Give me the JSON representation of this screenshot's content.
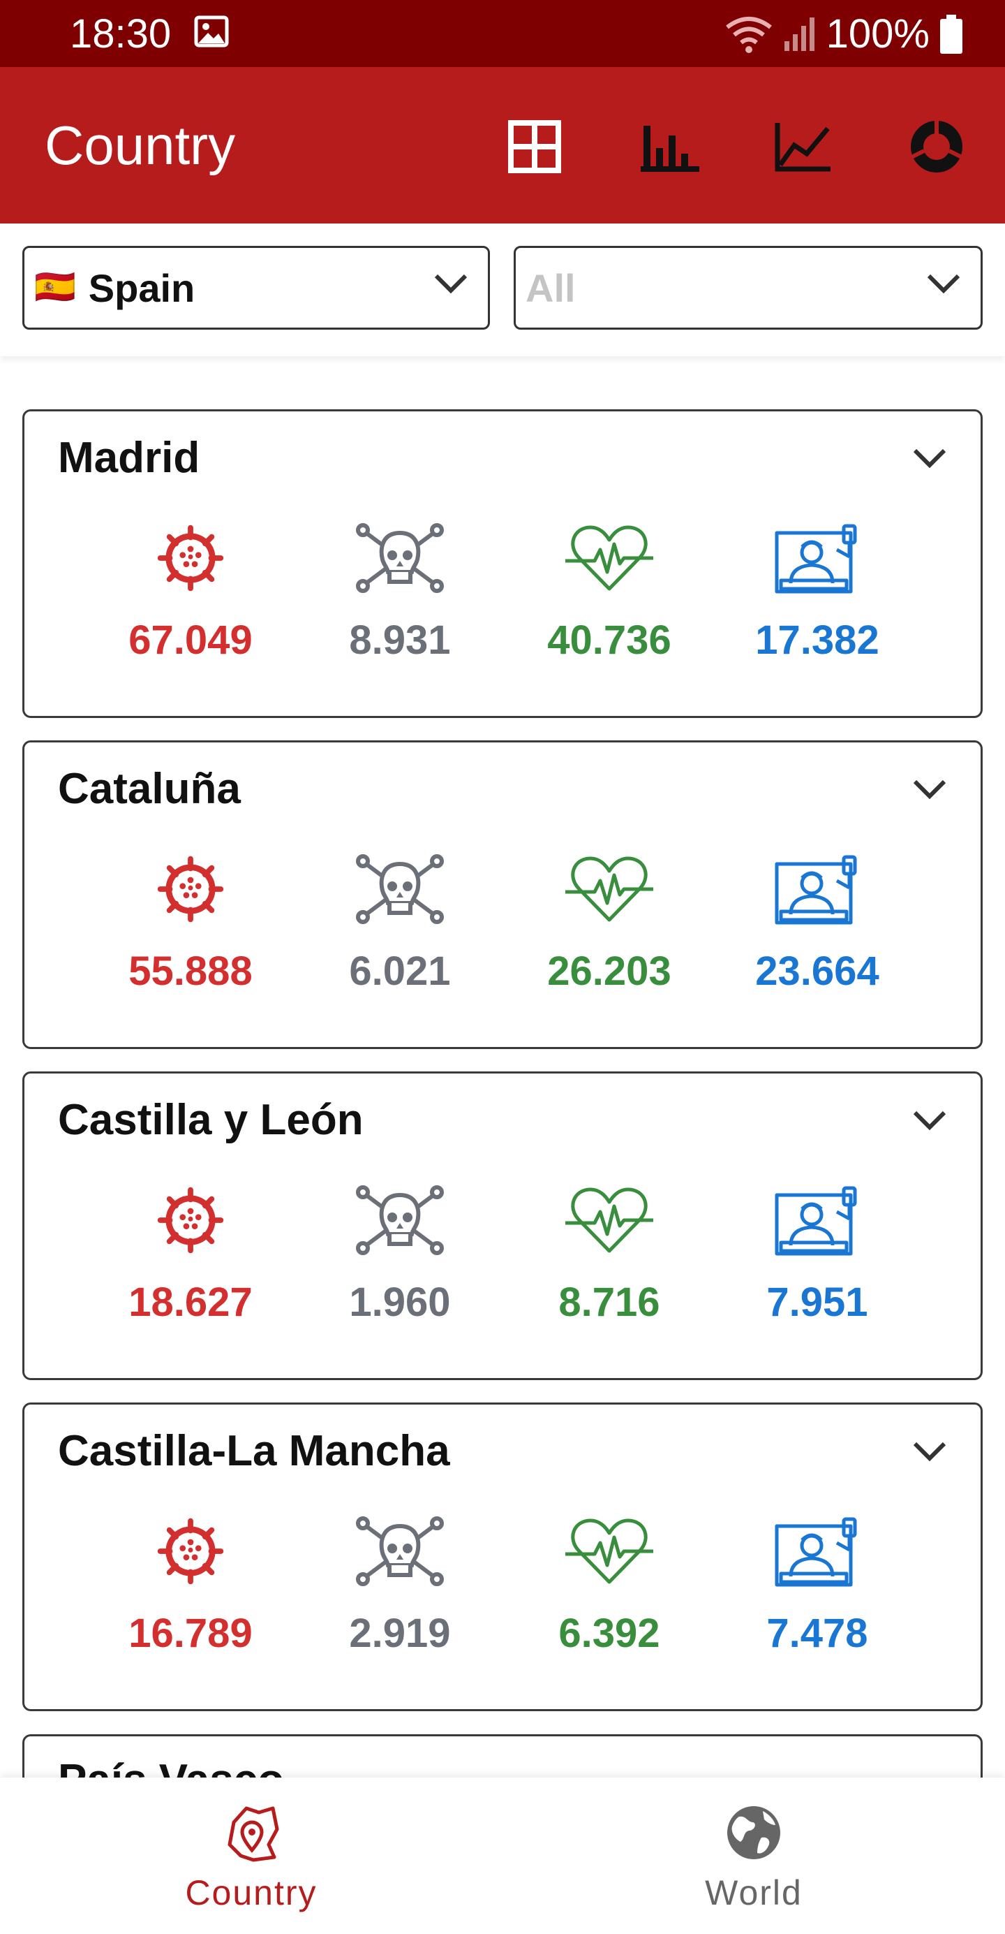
{
  "status": {
    "time": "18:30",
    "battery": "100%"
  },
  "app_bar": {
    "title": "Country"
  },
  "filters": {
    "country": {
      "flag": "🇪🇸",
      "value": "Spain"
    },
    "region": {
      "placeholder": "All"
    }
  },
  "regions": [
    {
      "name": "Madrid",
      "confirmed": "67.049",
      "deaths": "8.931",
      "recovered": "40.736",
      "hospitalized": "17.382"
    },
    {
      "name": "Cataluña",
      "confirmed": "55.888",
      "deaths": "6.021",
      "recovered": "26.203",
      "hospitalized": "23.664"
    },
    {
      "name": "Castilla y León",
      "confirmed": "18.627",
      "deaths": "1.960",
      "recovered": "8.716",
      "hospitalized": "7.951"
    },
    {
      "name": "Castilla-La Mancha",
      "confirmed": "16.789",
      "deaths": "2.919",
      "recovered": "6.392",
      "hospitalized": "7.478"
    },
    {
      "name": "País Vasco"
    }
  ],
  "bottom_nav": {
    "country": "Country",
    "world": "World"
  },
  "colors": {
    "status_bar": "#7e0000",
    "app_bar": "#b71c1c",
    "confirmed": "#d32f2f",
    "deaths": "#6b6f77",
    "recovered": "#388e3c",
    "hospitalized": "#1976d2"
  },
  "icons": {
    "app_bar": [
      "grid-icon",
      "bar-chart-icon",
      "line-chart-icon",
      "donut-chart-icon"
    ],
    "stats": [
      "virus-icon",
      "skull-crossbones-icon",
      "heart-pulse-icon",
      "hospital-bed-icon"
    ],
    "nav": [
      "map-pin-icon",
      "globe-icon"
    ]
  }
}
